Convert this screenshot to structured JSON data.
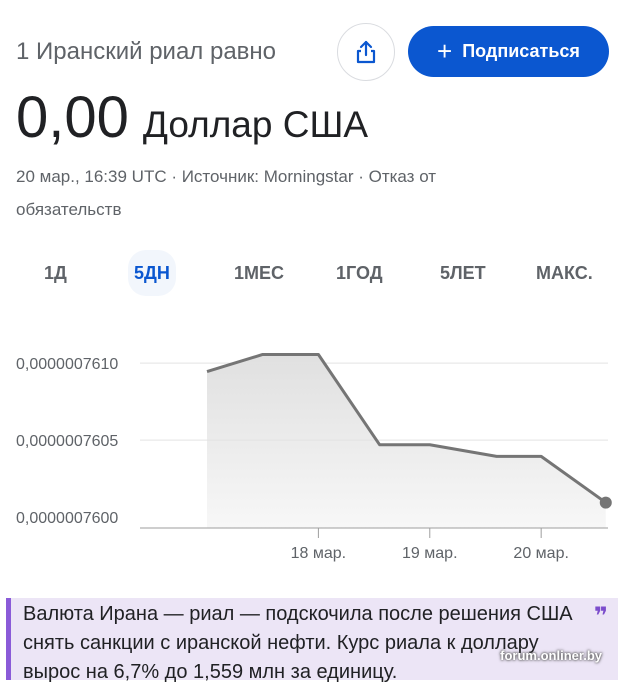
{
  "header": {
    "subtitle": "1 Иранский риал равно",
    "share_icon": "share-icon",
    "subscribe_label": "Подписаться",
    "subscribe_icon": "+"
  },
  "rate": {
    "value": "0,00",
    "currency": "Доллар США"
  },
  "meta": {
    "text": "20 мар., 16:39 UTC · Источник: Morningstar · Отказ от обязательств"
  },
  "tabs": [
    {
      "label": "1Д",
      "active": false
    },
    {
      "label": "5ДН",
      "active": true
    },
    {
      "label": "1МЕС",
      "active": false
    },
    {
      "label": "1ГОД",
      "active": false
    },
    {
      "label": "5ЛЕТ",
      "active": false
    },
    {
      "label": "МАКС.",
      "active": false
    }
  ],
  "chart_data": {
    "type": "area",
    "title": "",
    "xlabel": "",
    "ylabel": "",
    "x_ticks": [
      "18 мар.",
      "19 мар.",
      "20 мар."
    ],
    "y_ticks": [
      "0,0000007610",
      "0,0000007605",
      "0,0000007600"
    ],
    "ylim": [
      7.5993e-07,
      7.6115e-07
    ],
    "series": [
      {
        "name": "",
        "points": [
          {
            "x": 17.0,
            "y": 7.60945e-07
          },
          {
            "x": 17.5,
            "y": 7.61056e-07
          },
          {
            "x": 18.0,
            "y": 7.61056e-07
          },
          {
            "x": 18.55,
            "y": 7.6047e-07
          },
          {
            "x": 19.0,
            "y": 7.6047e-07
          },
          {
            "x": 19.6,
            "y": 7.60395e-07
          },
          {
            "x": 20.0,
            "y": 7.60395e-07
          },
          {
            "x": 20.58,
            "y": 7.60095e-07
          }
        ]
      }
    ],
    "line_color": "#757575",
    "fill_color": "#e0e0e0",
    "grid": false,
    "legend": "none"
  },
  "news": {
    "text": "Валюта Ирана — риал — подскочила после решения США снять санкции с иранской нефти. Курс риала к доллару вырос на 6,7% до 1,559 млн за единицу.",
    "quote_icon": "❞",
    "watermark": "forum.onliner.by"
  }
}
